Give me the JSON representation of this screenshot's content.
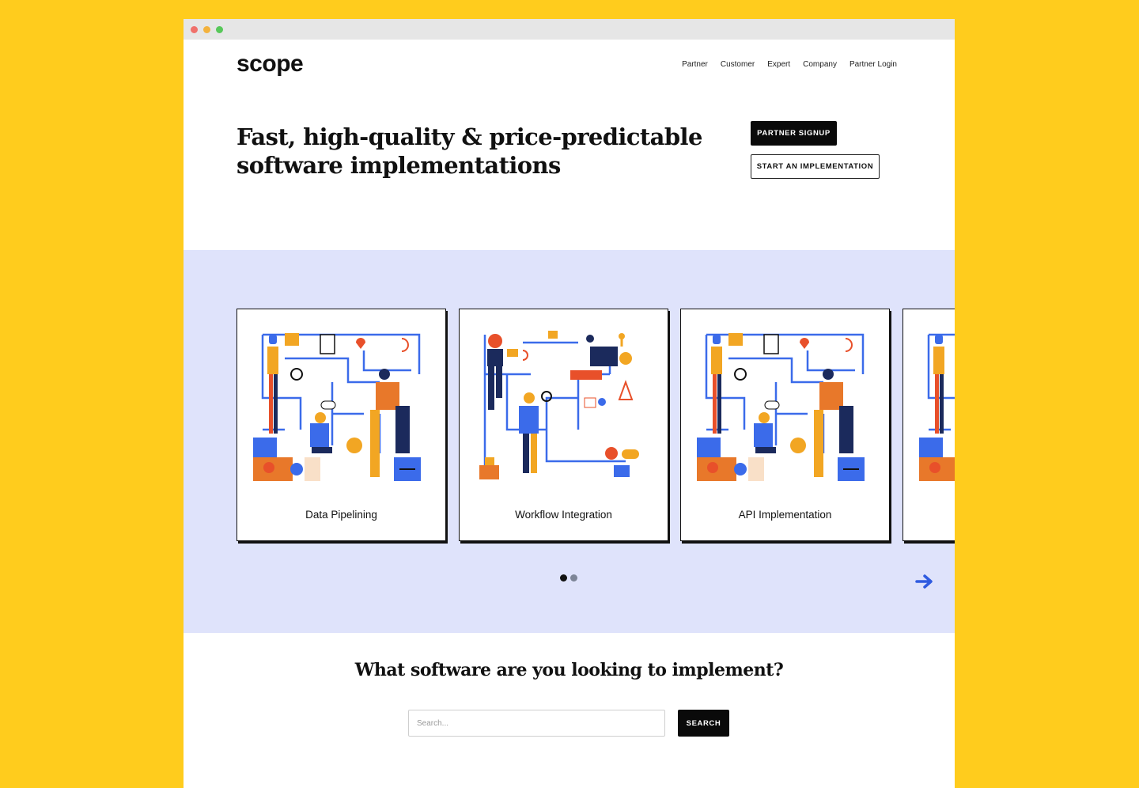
{
  "brand": {
    "logo": "scope",
    "background": "#FFCC1D",
    "band": "#DFE3FB"
  },
  "nav": {
    "items": [
      "Partner",
      "Customer",
      "Expert",
      "Company",
      "Partner Login"
    ]
  },
  "hero": {
    "title_line1": "Fast, high-quality & price-predictable",
    "title_line2": "software implementations",
    "primary_button": "PARTNER SIGNUP",
    "secondary_button": "START AN IMPLEMENTATION"
  },
  "carousel": {
    "cards": [
      {
        "label": "Data Pipelining",
        "illustration": "team-pipes-illustration"
      },
      {
        "label": "Workflow Integration",
        "illustration": "workflow-illustration"
      },
      {
        "label": "API Implementation",
        "illustration": "team-pipes-illustration"
      },
      {
        "label": "",
        "illustration": "team-pipes-illustration"
      }
    ],
    "active_page": 1,
    "page_count": 2,
    "next_icon": "arrow-right-icon"
  },
  "search": {
    "title": "What software are you looking to implement?",
    "placeholder": "Search...",
    "button": "SEARCH"
  }
}
